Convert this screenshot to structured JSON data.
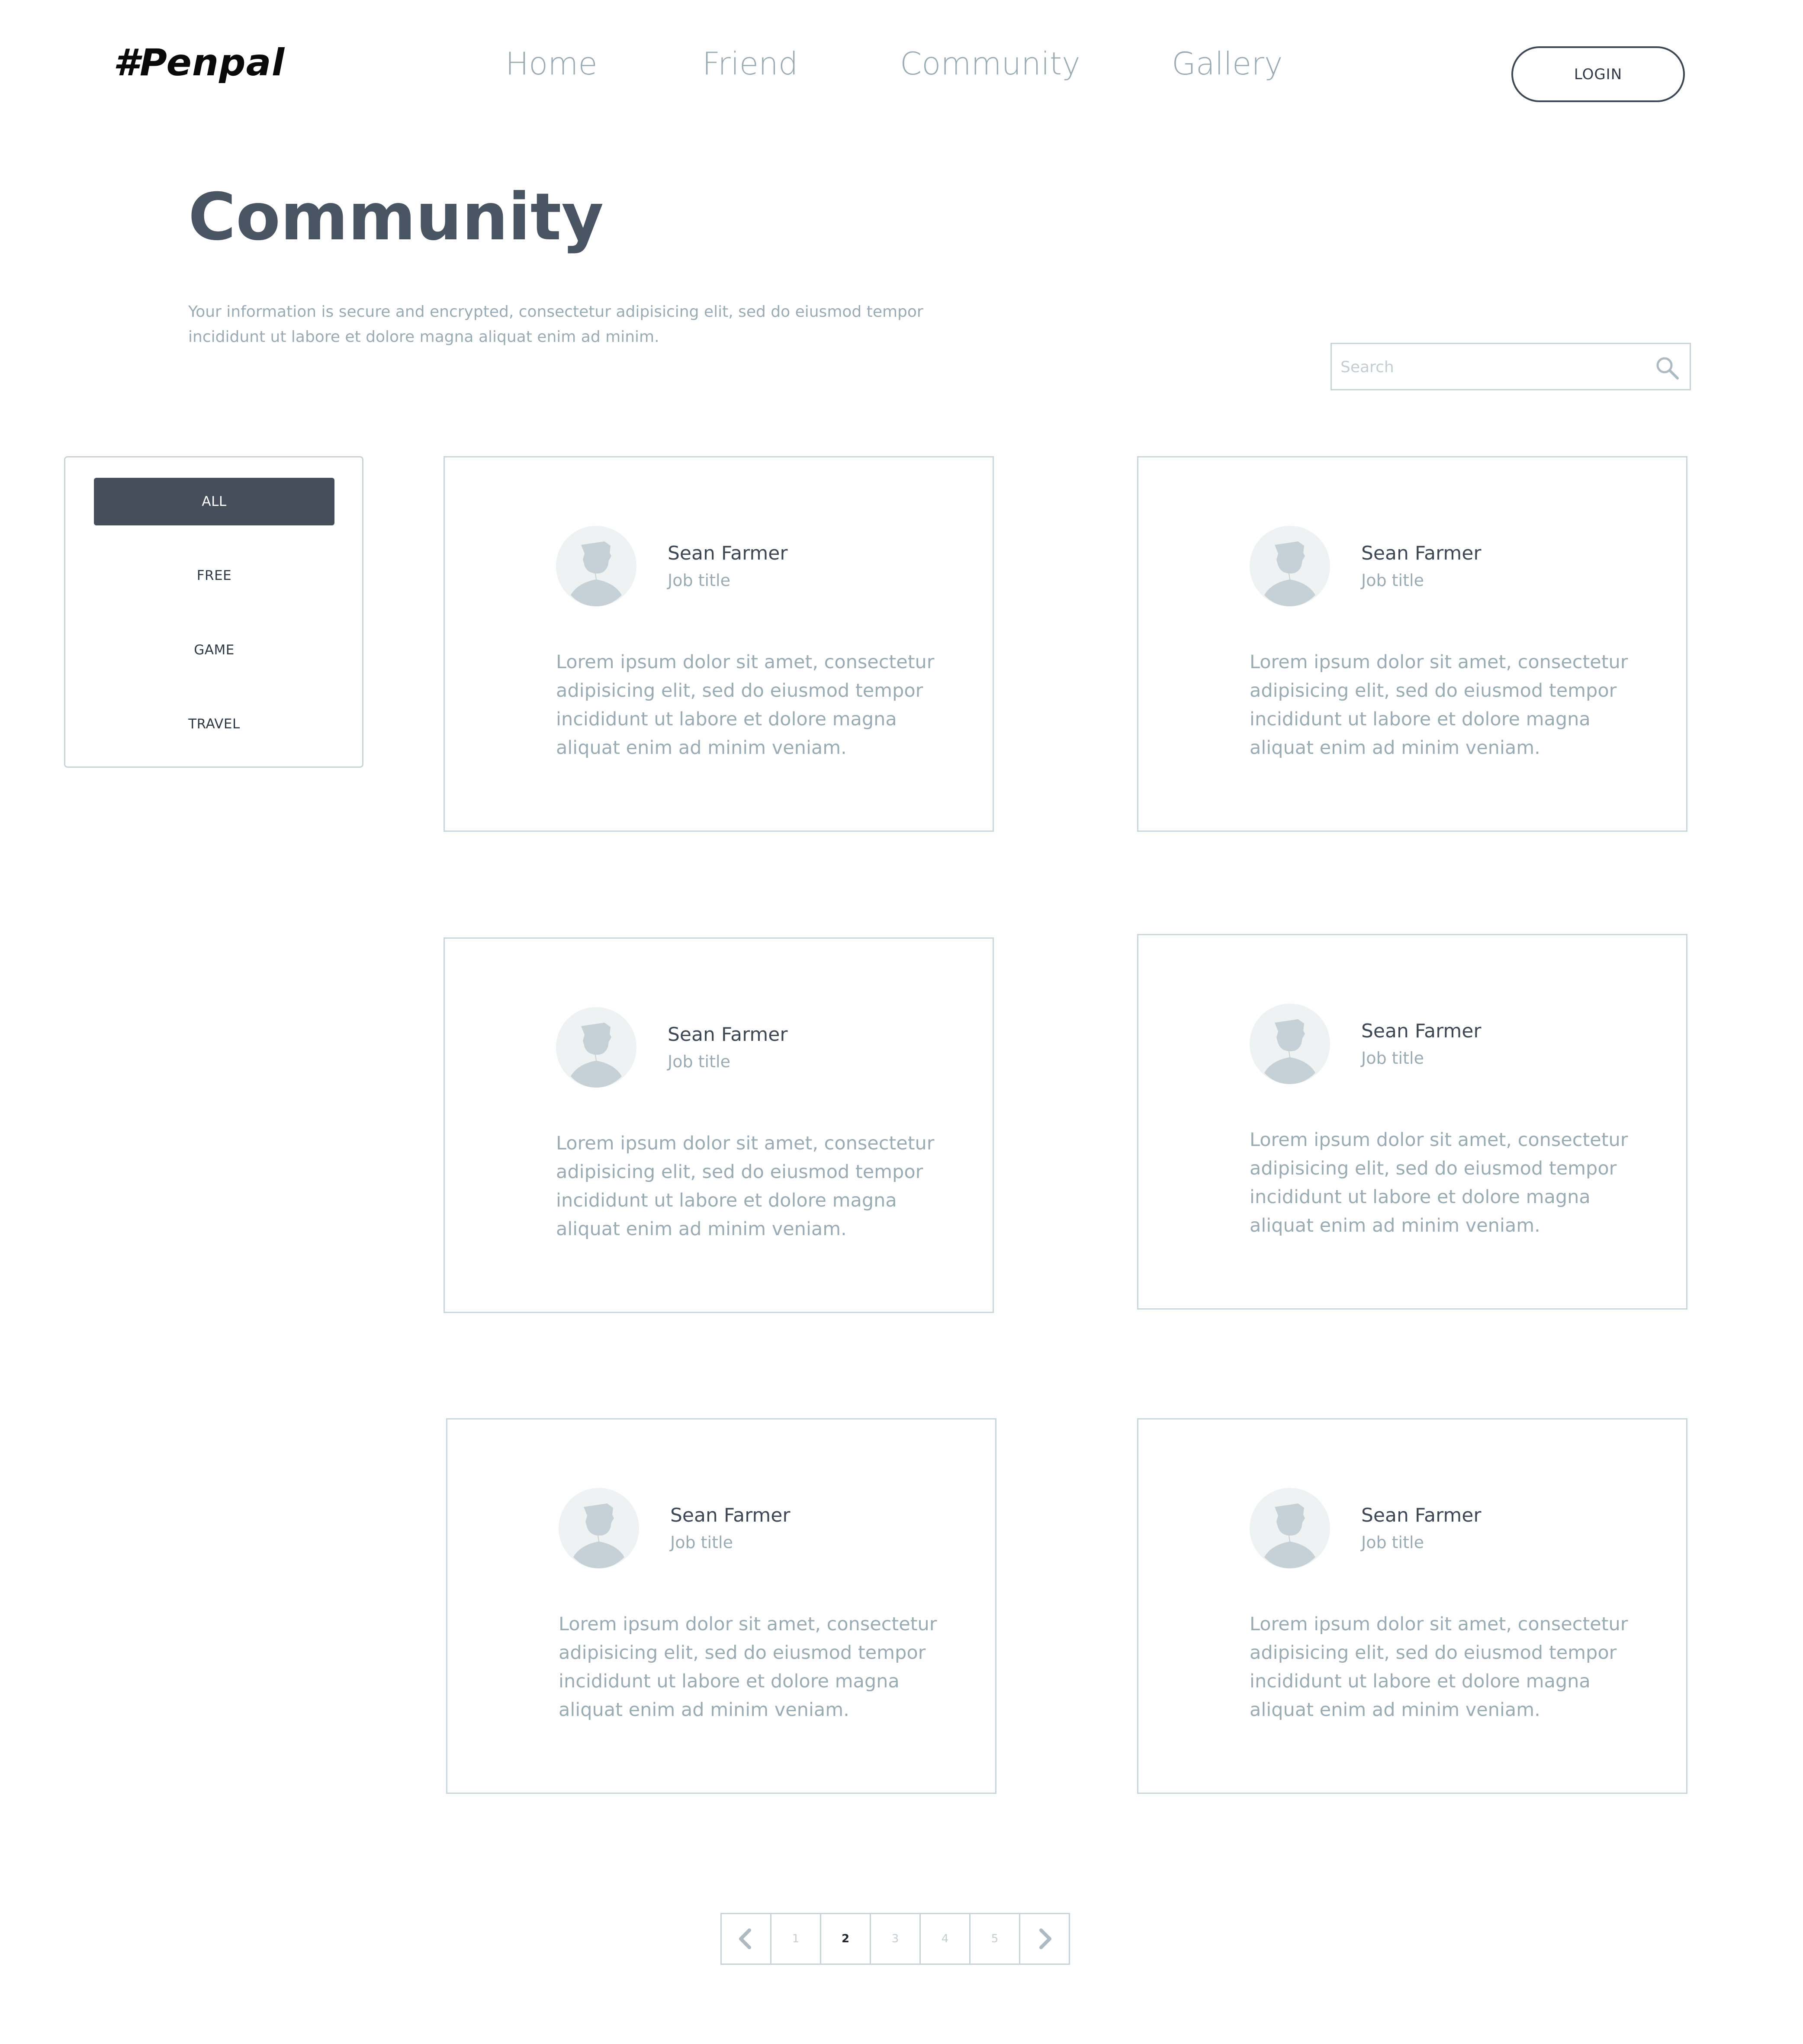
{
  "header": {
    "logo": "#Penpal",
    "nav": [
      "Home",
      "Friend",
      "Community",
      "Gallery"
    ],
    "login_label": "LOGIN"
  },
  "page": {
    "title": "Community",
    "intro_line1": "Your information is secure and encrypted, consectetur adipisicing elit, sed do eiusmod tempor",
    "intro_line2": "incididunt ut labore et dolore magna aliquat enim ad minim."
  },
  "search": {
    "placeholder": "Search",
    "value": "",
    "icon": "search-icon"
  },
  "filters": {
    "items": [
      "ALL",
      "FREE",
      "GAME",
      "TRAVEL"
    ],
    "selected": "ALL"
  },
  "cards": [
    {
      "name": "Sean Farmer",
      "job": "Job title",
      "description": "Lorem ipsum dolor sit amet, consectetur adipisicing elit, sed do eiusmod tempor incididunt ut labore et dolore magna aliquat enim ad minim veniam."
    },
    {
      "name": "Sean Farmer",
      "job": "Job title",
      "description": "Lorem ipsum dolor sit amet, consectetur adipisicing elit, sed do eiusmod tempor incididunt ut labore et dolore magna aliquat enim ad minim veniam."
    },
    {
      "name": "Sean Farmer",
      "job": "Job title",
      "description": "Lorem ipsum dolor sit amet, consectetur adipisicing elit, sed do eiusmod tempor incididunt ut labore et dolore magna aliquat enim ad minim veniam."
    },
    {
      "name": "Sean Farmer",
      "job": "Job title",
      "description": "Lorem ipsum dolor sit amet, consectetur adipisicing elit, sed do eiusmod tempor incididunt ut labore et dolore magna aliquat enim ad minim veniam."
    },
    {
      "name": "Sean Farmer",
      "job": "Job title",
      "description": "Lorem ipsum dolor sit amet, consectetur adipisicing elit, sed do eiusmod tempor incididunt ut labore et dolore magna aliquat enim ad minim veniam."
    },
    {
      "name": "Sean Farmer",
      "job": "Job title",
      "description": "Lorem ipsum dolor sit amet, consectetur adipisicing elit, sed do eiusmod tempor incididunt ut labore et dolore magna aliquat enim ad minim veniam."
    }
  ],
  "pagination": {
    "prev_icon": "chevron-left-icon",
    "pages": [
      "1",
      "2",
      "3",
      "4",
      "5"
    ],
    "current": "2",
    "next_icon": "chevron-right-icon"
  },
  "colors": {
    "text_dark": "#4a5563",
    "text_muted": "#9aabb4",
    "border": "#c8d7dd",
    "filter_active_bg": "#464d5b",
    "avatar_bg": "#eff2f3",
    "avatar_figure": "#c5d1d6"
  }
}
